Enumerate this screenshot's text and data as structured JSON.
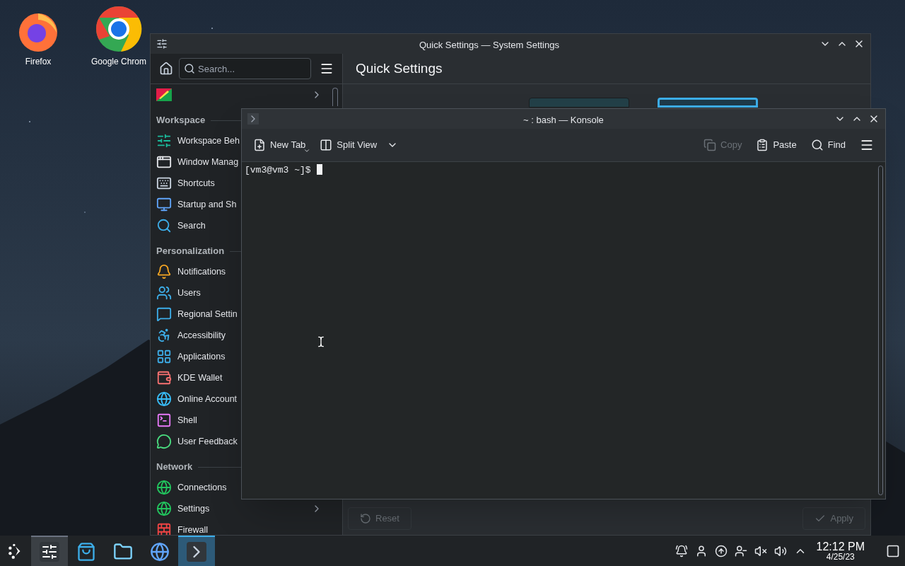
{
  "desktop": {
    "icons": [
      {
        "label": "Firefox",
        "kind": "fox"
      },
      {
        "label": "Google Chrom",
        "kind": "chrome"
      }
    ]
  },
  "settings_window": {
    "title": "Quick Settings — System Settings",
    "search": {
      "placeholder": "Search..."
    },
    "sidebar": {
      "top_item": {
        "submenu": true
      },
      "sections": [
        {
          "heading": "Workspace",
          "items": [
            {
              "label": "Workspace Beh",
              "submenu": false
            },
            {
              "label": "Window Manag",
              "submenu": false
            },
            {
              "label": "Shortcuts",
              "submenu": false
            },
            {
              "label": "Startup and Sh",
              "submenu": false
            },
            {
              "label": "Search",
              "submenu": false
            }
          ]
        },
        {
          "heading": "Personalization",
          "items": [
            {
              "label": "Notifications",
              "submenu": false
            },
            {
              "label": "Users",
              "submenu": false
            },
            {
              "label": "Regional Settin",
              "submenu": false
            },
            {
              "label": "Accessibility",
              "submenu": false
            },
            {
              "label": "Applications",
              "submenu": false
            },
            {
              "label": "KDE Wallet",
              "submenu": false
            },
            {
              "label": "Online Account",
              "submenu": false
            },
            {
              "label": "Shell",
              "submenu": false
            },
            {
              "label": "User Feedback",
              "submenu": false
            }
          ]
        },
        {
          "heading": "Network",
          "items": [
            {
              "label": "Connections",
              "submenu": false
            },
            {
              "label": "Settings",
              "submenu": true
            },
            {
              "label": "Firewall",
              "submenu": false
            }
          ]
        }
      ]
    },
    "page_title": "Quick Settings",
    "previews": [
      {
        "selected": false
      },
      {
        "selected": true
      }
    ],
    "buttons": [
      {
        "label": "Reset",
        "kind": "reset",
        "disabled": true
      },
      {
        "label": "Apply",
        "kind": "apply",
        "disabled": true
      }
    ]
  },
  "konsole": {
    "title": "~ : bash — Konsole",
    "toolbar": [
      {
        "label": "New Tab",
        "kind": "new-tab",
        "disabled": false
      },
      {
        "label": "Split View",
        "kind": "split-view",
        "disabled": false
      },
      {
        "label": "Copy",
        "kind": "copy",
        "disabled": true
      },
      {
        "label": "Paste",
        "kind": "paste",
        "disabled": false
      },
      {
        "label": "Find",
        "kind": "find",
        "disabled": false
      }
    ],
    "prompt": "[vm3@vm3 ~]$"
  },
  "taskbar": {
    "tasks": [
      {
        "kind": "settings",
        "open": true,
        "selected": false
      },
      {
        "kind": "store",
        "open": false,
        "selected": false
      },
      {
        "kind": "folder",
        "open": false,
        "selected": false
      },
      {
        "kind": "globe",
        "open": false,
        "selected": false
      },
      {
        "kind": "terminal",
        "open": true,
        "selected": true
      }
    ],
    "clock": {
      "time": "12:12 PM",
      "date": "4/25/23"
    }
  }
}
